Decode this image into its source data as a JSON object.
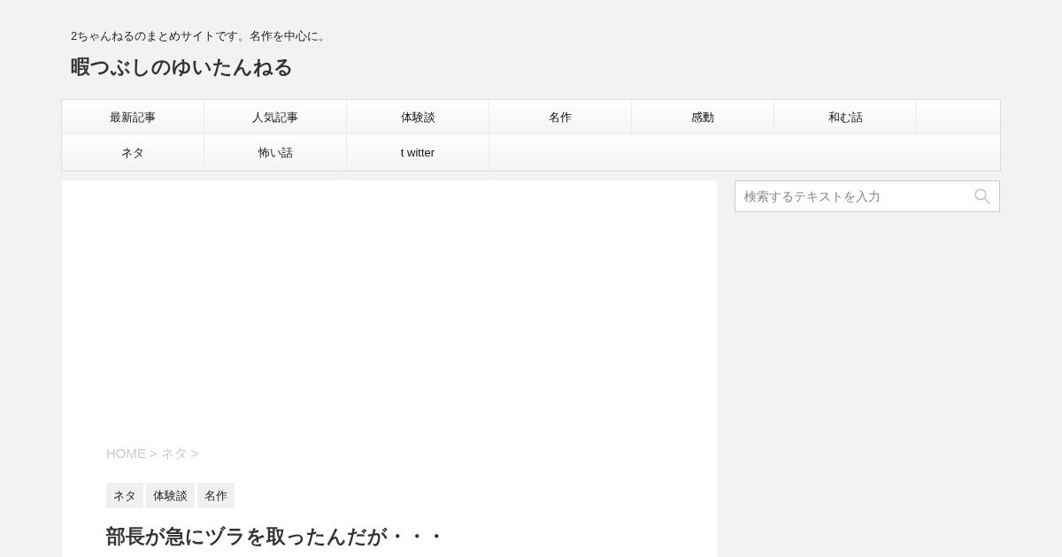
{
  "header": {
    "description": "2ちゃんねるのまとめサイトです。名作を中心に。",
    "site_title": "暇つぶしのゆいたんねる"
  },
  "nav": {
    "rows": [
      [
        "最新記事",
        "人気記事",
        "体験談",
        "名作",
        "感動",
        "和む話"
      ],
      [
        "ネタ",
        "怖い話",
        "t witter"
      ]
    ]
  },
  "article": {
    "breadcrumb": [
      {
        "label": "HOME",
        "separator": ">"
      },
      {
        "label": "ネタ",
        "separator": ">"
      }
    ],
    "tags": [
      "ネタ",
      "体験談",
      "名作"
    ],
    "title": "部長が急にヅラを取ったんだが・・・"
  },
  "sidebar": {
    "search": {
      "placeholder": "検索するテキストを入力"
    }
  }
}
